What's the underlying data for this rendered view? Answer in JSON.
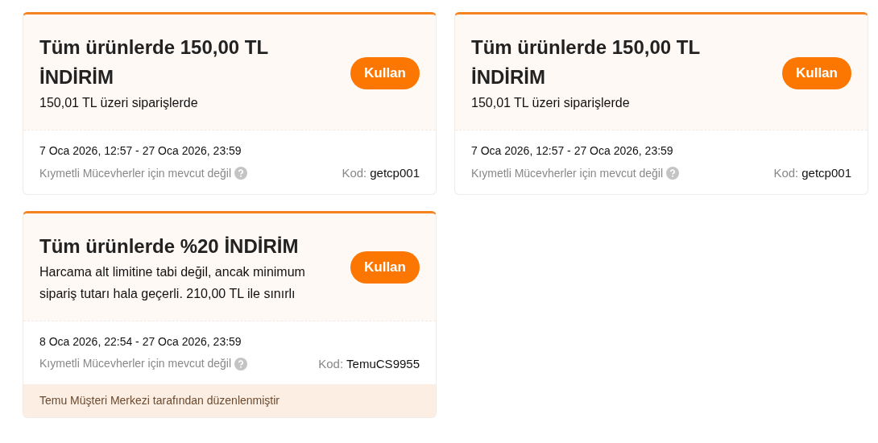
{
  "coupons": [
    {
      "title": "Tüm ürünlerde 150,00 TL İNDİRİM",
      "condition": "150,01 TL üzeri siparişlerde",
      "button": "Kullan",
      "validity": "7 Oca 2026, 12:57 - 27 Oca 2026, 23:59",
      "exclusion": "Kıymetli Mücevherler için mevcut değil",
      "code_label": "Kod:",
      "code": "getcp001"
    },
    {
      "title": "Tüm ürünlerde 150,00 TL İNDİRİM",
      "condition": "150,01 TL üzeri siparişlerde",
      "button": "Kullan",
      "validity": "7 Oca 2026, 12:57 - 27 Oca 2026, 23:59",
      "exclusion": "Kıymetli Mücevherler için mevcut değil",
      "code_label": "Kod:",
      "code": "getcp001"
    },
    {
      "title": "Tüm ürünlerde %20 İNDİRİM",
      "condition": "Harcama alt limitine tabi değil, ancak minimum sipariş tutarı hala geçerli. 210,00 TL ile sınırlı",
      "button": "Kullan",
      "validity": "8 Oca 2026, 22:54 - 27 Oca 2026, 23:59",
      "exclusion": "Kıymetli Mücevherler için mevcut değil",
      "code_label": "Kod:",
      "code": "TemuCS9955",
      "footer": "Temu Müşteri Merkezi tarafından düzenlenmiştir"
    }
  ]
}
